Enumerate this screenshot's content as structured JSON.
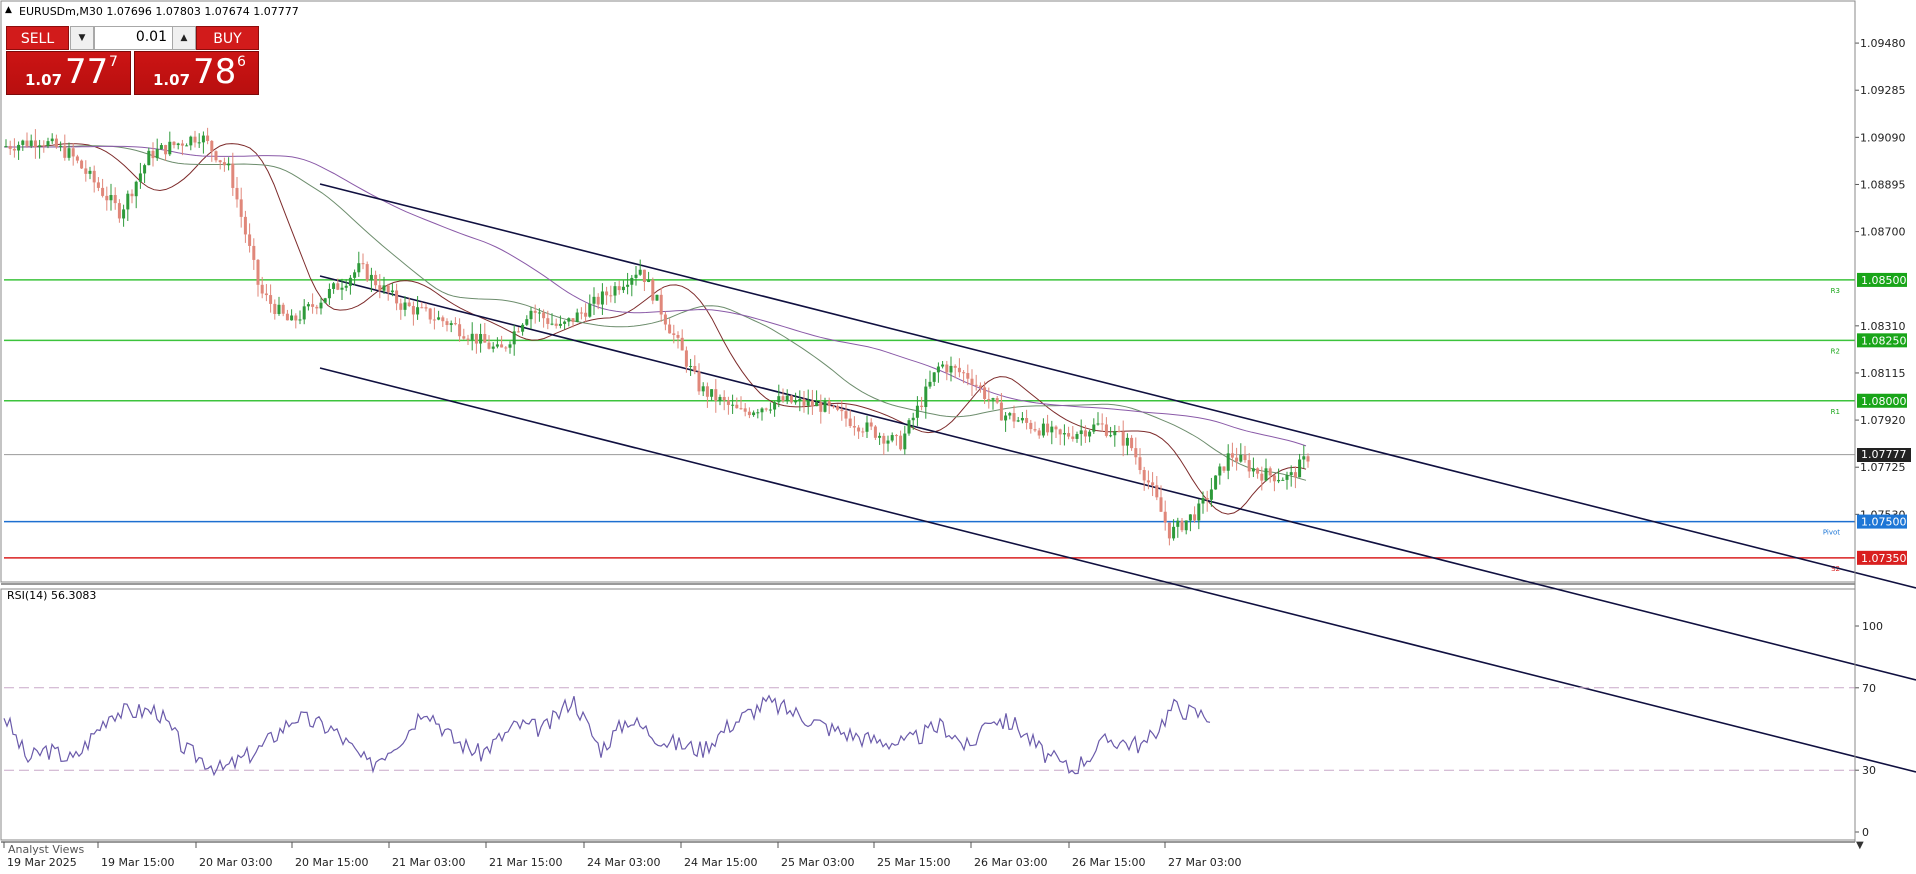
{
  "chart": {
    "symbol_title": "EURUSDm,M30  1.07696 1.07803 1.07674 1.07777",
    "rsi_title": "RSI(14) 56.3083",
    "analyst_label": "Analyst Views"
  },
  "trade_panel": {
    "sell_label": "SELL",
    "buy_label": "BUY",
    "volume": "0.01",
    "sell_quote": {
      "small": "1.07",
      "big": "77",
      "sup": "7"
    },
    "buy_quote": {
      "small": "1.07",
      "big": "78",
      "sup": "6"
    }
  },
  "price_axis": {
    "ticks": [
      "1.09480",
      "1.09285",
      "1.09090",
      "1.08895",
      "1.08700",
      "1.08310",
      "1.08115",
      "1.07920",
      "1.07725",
      "1.07530"
    ],
    "current_price": "1.07777",
    "range": [
      1.0725,
      1.0965
    ]
  },
  "levels": [
    {
      "price": 1.085,
      "label": "1.08500",
      "tag": "R3",
      "color": "#19a519",
      "line": "#3cc33c"
    },
    {
      "price": 1.0825,
      "label": "1.08250",
      "tag": "R2",
      "color": "#19a519",
      "line": "#3cc33c"
    },
    {
      "price": 1.08,
      "label": "1.08000",
      "tag": "R1",
      "color": "#19a519",
      "line": "#3cc33c"
    },
    {
      "price": 1.075,
      "label": "1.07500",
      "tag": "Pivot",
      "color": "#1d76d6",
      "line": "#1d6fd0"
    },
    {
      "price": 1.0735,
      "label": "1.07350",
      "tag": "S2",
      "color": "#d92020",
      "line": "#d92020"
    }
  ],
  "rsi_axis": {
    "ticks": [
      "100",
      "70",
      "30",
      "0"
    ],
    "levels": [
      70,
      30
    ]
  },
  "time_axis": {
    "labels": [
      "19 Mar 2025",
      "19 Mar 15:00",
      "20 Mar 03:00",
      "20 Mar 15:00",
      "21 Mar 03:00",
      "21 Mar 15:00",
      "24 Mar 03:00",
      "24 Mar 15:00",
      "25 Mar 03:00",
      "25 Mar 15:00",
      "26 Mar 03:00",
      "26 Mar 15:00",
      "27 Mar 03:00"
    ]
  },
  "colors": {
    "bull": "#2e9a3a",
    "bear": "#e0877a",
    "rsi": "#6a5aaa",
    "channel": "#101040",
    "ma1": "#7d2b2b",
    "ma2": "#6d8d6d",
    "ma3": "#8a5aa8"
  },
  "icons": {
    "title_arrow": "triangle-up-icon",
    "dropdown": "triangle-down-icon",
    "spin": "triangle-up-icon"
  }
}
